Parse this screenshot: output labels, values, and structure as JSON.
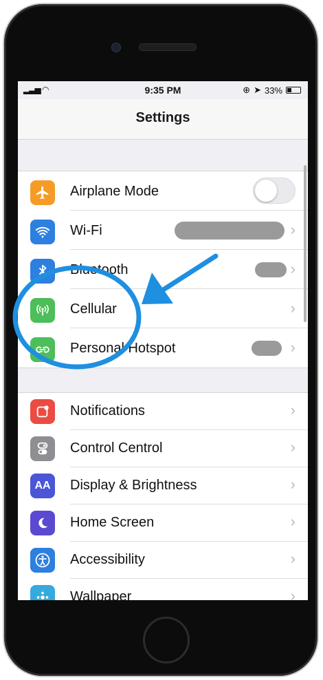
{
  "status_bar": {
    "time": "9:35 PM",
    "battery": "33%"
  },
  "navigation": {
    "title": "Settings"
  },
  "groups": [
    {
      "rows": [
        {
          "label": "Airplane Mode",
          "icon": "airplane-icon",
          "color": "#f59c27",
          "accessory": "toggle",
          "toggle_on": false
        },
        {
          "label": "Wi-Fi",
          "icon": "wifi-icon",
          "color": "#2d7fe0",
          "accessory": "value-hidden"
        },
        {
          "label": "Bluetooth",
          "icon": "bluetooth-icon",
          "color": "#2d7fe0",
          "accessory": "value-hidden"
        },
        {
          "label": "Cellular",
          "icon": "cellular-antenna-icon",
          "color": "#4cbe5a",
          "accessory": "chevron"
        },
        {
          "label": "Personal Hotspot",
          "icon": "hotspot-link-icon",
          "color": "#4cbe5a",
          "accessory": "value-hidden"
        }
      ]
    },
    {
      "rows": [
        {
          "label": "Notifications",
          "icon": "notifications-icon",
          "color": "#ea4c43"
        },
        {
          "label": "Control Centrol",
          "icon": "control-centre-icon",
          "color": "#8e8e93"
        },
        {
          "label": "Display & Brightness",
          "icon": "display-brightness-icon",
          "color": "#4a56d6",
          "icon_text": "AA"
        },
        {
          "label": "Home Screen",
          "icon": "home-screen-icon",
          "color": "#5a4ad1"
        },
        {
          "label": "Accessibility",
          "icon": "accessibility-icon",
          "color": "#2d7fe0"
        },
        {
          "label": "Wallpaper",
          "icon": "wallpaper-icon",
          "color": "#35aadc"
        }
      ]
    }
  ],
  "colors": {
    "annotation_blue": "#1f8fe0",
    "chevron": "#b9b9bf"
  }
}
